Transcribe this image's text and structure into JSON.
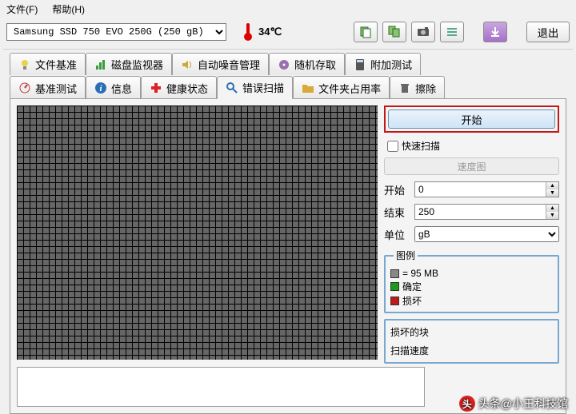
{
  "menu": {
    "file": "文件(F)",
    "help": "帮助(H)"
  },
  "drive": "Samsung SSD 750 EVO 250G (250 gB)",
  "temperature": "34℃",
  "exit_label": "退出",
  "tabs_row1": [
    {
      "id": "file-benchmark",
      "label": "文件基准",
      "icon": "lightbulb",
      "color": "#e8d34a"
    },
    {
      "id": "disk-monitor",
      "label": "磁盘监视器",
      "icon": "chart",
      "color": "#3a9c3a"
    },
    {
      "id": "aam",
      "label": "自动噪音管理",
      "icon": "speaker",
      "color": "#caa83a"
    },
    {
      "id": "random-access",
      "label": "随机存取",
      "icon": "disk",
      "color": "#9a6fae"
    },
    {
      "id": "extra-tests",
      "label": "附加测试",
      "icon": "calc",
      "color": "#555"
    }
  ],
  "tabs_row2": [
    {
      "id": "benchmark",
      "label": "基准测试",
      "icon": "gauge",
      "color": "#c23a3a"
    },
    {
      "id": "info",
      "label": "信息",
      "icon": "info",
      "color": "#2a6fb5"
    },
    {
      "id": "health",
      "label": "健康状态",
      "icon": "plus",
      "color": "#d22"
    },
    {
      "id": "error-scan",
      "label": "错误扫描",
      "icon": "search",
      "color": "#2a6fb5",
      "active": true
    },
    {
      "id": "folder-usage",
      "label": "文件夹占用率",
      "icon": "folder",
      "color": "#d9a93a"
    },
    {
      "id": "erase",
      "label": "擦除",
      "icon": "trash",
      "color": "#666"
    }
  ],
  "side": {
    "start": "开始",
    "quick_scan": "快速扫描",
    "speed_map": "速度图",
    "start_label": "开始",
    "start_val": "0",
    "end_label": "结束",
    "end_val": "250",
    "unit_label": "单位",
    "unit_val": "gB",
    "legend_title": "图例",
    "legend_unused": "= 95 MB",
    "legend_ok": "确定",
    "legend_damaged": "损坏",
    "stat_damaged": "损坏的块",
    "stat_speed": "扫描速度"
  },
  "colors": {
    "unused": "#888888",
    "ok": "#1a9c1a",
    "damaged": "#c21818"
  },
  "watermark": "头条@小王科技馆"
}
